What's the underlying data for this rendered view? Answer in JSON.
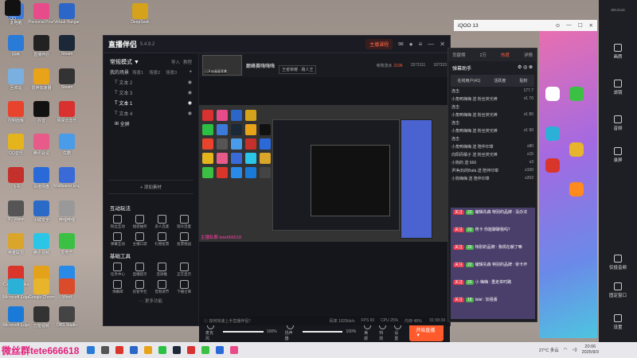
{
  "desktop_icons": [
    {
      "label": "此电脑",
      "color": "#3b7ad8"
    },
    {
      "label": "Personal Proxy",
      "color": "#e84b8a"
    },
    {
      "label": "Virtual Hangar",
      "color": "#2b66c8"
    },
    {
      "label": "WPS Office",
      "color": "#d9352b"
    },
    {
      "label": "DeepSeek",
      "color": "#d4a21b"
    },
    {
      "label": "QQ",
      "color": "#111"
    },
    {
      "label": "网络",
      "color": "#2a7ad8"
    },
    {
      "label": "直播伴侣",
      "color": "#222"
    },
    {
      "label": "Steam",
      "color": "#1b2838"
    },
    {
      "label": "微信",
      "color": "#2bbf43"
    },
    {
      "label": "回收站",
      "color": "#7ab0e0"
    },
    {
      "label": "雷神加速器",
      "color": "#e8a319"
    },
    {
      "label": "Steam",
      "color": "#333"
    },
    {
      "label": "Chrome",
      "color": "#e84b3c"
    },
    {
      "label": "控制面板",
      "color": "#e8432c"
    },
    {
      "label": "抖音",
      "color": "#111"
    },
    {
      "label": "网易云音乐",
      "color": "#d93030"
    },
    {
      "label": "QQ音乐",
      "color": "#e4b41d"
    },
    {
      "label": "腾讯会议",
      "color": "#e75a8a"
    },
    {
      "label": "优酷",
      "color": "#4a9be8"
    },
    {
      "label": "飞书",
      "color": "#c4302b"
    },
    {
      "label": "百度网盘",
      "color": "#2a6ad8"
    },
    {
      "label": "Wallpaper Engine",
      "color": "#3a6ad8"
    },
    {
      "label": "剪映",
      "color": "#1a7ad8"
    },
    {
      "label": "3D Vision",
      "color": "#555"
    },
    {
      "label": "火绒安全",
      "color": "#2c6ac8"
    },
    {
      "label": "哔哩哔哩",
      "color": "#999"
    },
    {
      "label": "英雄联盟",
      "color": "#d9a52b"
    },
    {
      "label": "腾讯视频",
      "color": "#2bc5e8"
    },
    {
      "label": "爱奇艺",
      "color": "#3bc043"
    },
    {
      "label": "Counter-Strike 2",
      "color": "#d9352b"
    },
    {
      "label": "PUBG",
      "color": "#e4a21b"
    },
    {
      "label": "ToDesk",
      "color": "#2a8ae8"
    },
    {
      "label": "Microsoft Edge",
      "color": "#2bb1d8"
    },
    {
      "label": "Google Chrome",
      "color": "#e8b42c"
    },
    {
      "label": "Word",
      "color": "#d94b2b"
    },
    {
      "label": "Microsoft Edge",
      "color": "#1a7ad8"
    },
    {
      "label": "万能视频",
      "color": "#333"
    },
    {
      "label": "OBS Studio",
      "color": "#444"
    },
    {
      "label": "网易云",
      "color": "#d92a2a"
    }
  ],
  "app": {
    "name": "直播伴侣",
    "version": "5.4.9.2",
    "anchor_btn": "主播课程",
    "scene_mode": "常规模式 ▼",
    "import_label": "导入",
    "tutorial_label": "教程",
    "scenes_label": "我的场景",
    "scene_tabs": [
      "场景1",
      "场景2",
      "场景3"
    ],
    "scene_sub": [
      "文本 2",
      "文本 3",
      "文本 1",
      "文本 4"
    ],
    "scene_all": "全屏",
    "add_material": "+ 添加素材",
    "interact_title": "互动玩法",
    "interact_items": [
      "粉丝互动",
      "福袋抽奖",
      "多人连麦",
      "观众连麦",
      "弹幕互动",
      "主播口袋",
      "礼物投票",
      "投票挑战"
    ],
    "tools_title": "基础工具",
    "tools_items": [
      "任务中心",
      "直播提示",
      "连屏推",
      "正在显示",
      "弹幕库",
      "房管专栏",
      "音频调节",
      "下播仓库"
    ],
    "more_funcs": "⋯ 更多功能"
  },
  "header": {
    "thumb_caption": "已开启画面背景",
    "room_title": "巅峰赛嗨嗨嗨",
    "room_tag": "王者荣耀 · 路人王",
    "stats": [
      {
        "label": "考核流水",
        "value": "2196",
        "red": true
      },
      {
        "label": "",
        "value": "1573111",
        "red": false
      },
      {
        "label": "",
        "value": "187333",
        "red": false
      }
    ]
  },
  "preview": {
    "label": "主播私聊 tete666618",
    "app_colors": [
      "#d93030",
      "#e84b8a",
      "#2b66c8",
      "#d4a21b",
      "#333",
      "#2bbf43",
      "#3b7ad8",
      "#1b2838",
      "#e8a319",
      "#111",
      "#e8432c",
      "#555",
      "#4a9be8",
      "#c4302b",
      "#2a6ad8",
      "#e4b41d",
      "#e75a8a",
      "#3a6ad8",
      "#2bc5e8",
      "#d9a52b",
      "#3bc043",
      "#d9352b",
      "#2a8ae8",
      "#1a7ad8",
      "#444"
    ]
  },
  "controls": {
    "mic_label": "麦克风",
    "mic_pct": "100%",
    "mic_level": 1.0,
    "speaker_label": "扬声器",
    "speaker_pct": "100%",
    "speaker_level": 1.0,
    "right_ctls": [
      "美颜",
      "特效",
      "设置"
    ],
    "start_btn": "开始直播 ▼"
  },
  "statusbar": {
    "tip": "ⓘ 如何快速上手直播伴侣？",
    "metrics": [
      "码率 1825kb/s",
      "FPS 60",
      "CPU 25%",
      "内存 48%"
    ],
    "time": "01:58:39"
  },
  "helper": {
    "tabs": [
      "贡献榜",
      "2万",
      "热度",
      "详情"
    ],
    "title": "弹幕助手",
    "sub": [
      "在线用户(41)",
      "活跃度",
      "贴粉"
    ],
    "messages": [
      {
        "text": "连击",
        "right": "177.7"
      },
      {
        "text": "小角鸭嗨嗨 送 粉丝荧光棒",
        "right": "x1 70"
      },
      {
        "text": "连击",
        "right": ""
      },
      {
        "text": "小角鸭嗨嗨 送 粉丝荧光棒",
        "right": "x1 80"
      },
      {
        "text": "连击",
        "right": ""
      },
      {
        "text": "小角鸭嗨嗨 送 粉丝荧光棒",
        "right": "x1 90"
      },
      {
        "text": "连击",
        "right": ""
      },
      {
        "text": "小角鸭嗨嗨 送 陪伴印章",
        "right": "x80"
      },
      {
        "text": "向阳而橘子 送 粉丝荧光棒",
        "right": "x15"
      },
      {
        "text": "小狗的 送 666",
        "right": "x3"
      },
      {
        "text": "尹净(8)的Bafa 送 陪伴印章",
        "right": "x100"
      },
      {
        "text": "小狗嗨嗨 送 陪伴印章",
        "right": "x202"
      }
    ],
    "chat": [
      {
        "badge": "关注",
        "lv": "22",
        "text": "编辑先森  特别的品牌 : 没办法"
      },
      {
        "badge": "关注",
        "lv": "20",
        "text": "佟卡 你能聊聊我吗？"
      },
      {
        "badge": "关注",
        "lv": "25",
        "text": "特别的品牌 : 我现在躺了嘛"
      },
      {
        "badge": "关注",
        "lv": "22",
        "text": "编辑先森  特别的品牌 : 依卡坏"
      },
      {
        "badge": "关注",
        "lv": "20",
        "text": "小 嗨嗨 : 重走单时路"
      },
      {
        "badge": "关注",
        "lv": "18",
        "text": "lalal : 加强版"
      }
    ]
  },
  "phone": {
    "title": "iQOO 13",
    "app_colors": [
      "#ffffff",
      "#3bc043",
      "#2bb1d8",
      "#e8b42c",
      "#d9352b",
      "#ff8a1d"
    ]
  },
  "sidebar": {
    "items": [
      "画质",
      "滤镜",
      "音频",
      "录屏",
      "仅投音频",
      "固定窗口",
      "设置"
    ],
    "top_text": "8913118"
  },
  "taskbar": {
    "watermark": "微丝群tete666618",
    "weather": "27°C 多云",
    "time": "20:06",
    "date": "2025/9/3",
    "icon_colors": [
      "#2a7ad8",
      "#555",
      "#d9352b",
      "#2b66c8",
      "#e8a319",
      "#2bbf43",
      "#1b2838",
      "#d93030",
      "#3bc043",
      "#2a6ad8",
      "#e84b8a"
    ]
  }
}
